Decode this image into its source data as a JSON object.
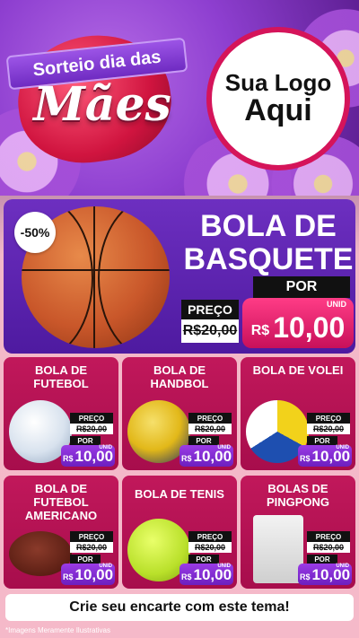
{
  "header": {
    "banner_line1": "Sorteio dia das",
    "banner_line2": "Mães",
    "logo_line1": "Sua Logo",
    "logo_line2": "Aqui"
  },
  "featured": {
    "discount": "-50%",
    "title": "BOLA DE BASQUETE",
    "por_label": "POR",
    "preco_label": "PREÇO",
    "old_price": "R$20,00",
    "currency": "R$",
    "price": "10,00",
    "unit": "UNID"
  },
  "products": [
    {
      "title": "BOLA DE FUTEBOL",
      "preco_label": "PREÇO",
      "old_price": "R$20,00",
      "por_label": "POR",
      "currency": "R$",
      "price": "10,00",
      "unit": "UNID"
    },
    {
      "title": "BOLA DE HANDBOL",
      "preco_label": "PREÇO",
      "old_price": "R$20,00",
      "por_label": "POR",
      "currency": "R$",
      "price": "10,00",
      "unit": "UNID"
    },
    {
      "title": "BOLA DE VOLEI",
      "preco_label": "PREÇO",
      "old_price": "R$20,00",
      "por_label": "POR",
      "currency": "R$",
      "price": "10,00",
      "unit": "UNID"
    },
    {
      "title": "BOLA DE FUTEBOL AMERICANO",
      "preco_label": "PREÇO",
      "old_price": "R$20,00",
      "por_label": "POR",
      "currency": "R$",
      "price": "10,00",
      "unit": "UNID"
    },
    {
      "title": "BOLA DE TENIS",
      "preco_label": "PREÇO",
      "old_price": "R$20,00",
      "por_label": "POR",
      "currency": "R$",
      "price": "10,00",
      "unit": "UNID"
    },
    {
      "title": "BOLAS DE PINGPONG",
      "preco_label": "PREÇO",
      "old_price": "R$20,00",
      "por_label": "POR",
      "currency": "R$",
      "price": "10,00",
      "unit": "UNID"
    }
  ],
  "cta": "Crie seu encarte com este tema!",
  "footnote": "*Imagens Meramente Ilustrativas",
  "colors": {
    "purple": "#6d2fc0",
    "magenta": "#c1185b",
    "pink_price": "#ff3c86",
    "background_pink": "#f5b9c9"
  }
}
